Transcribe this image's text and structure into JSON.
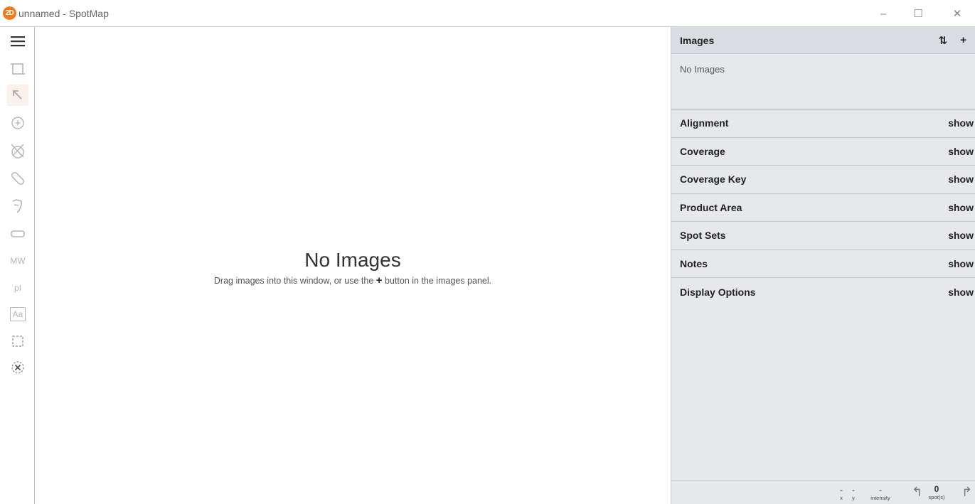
{
  "window": {
    "logo_text": "2D",
    "title": "unnamed - SpotMap",
    "minimize_glyph": "–",
    "maximize_glyph": "☐",
    "close_glyph": "✕"
  },
  "toolbar": {
    "tools": [
      {
        "name": "menu-icon"
      },
      {
        "name": "crop-icon"
      },
      {
        "name": "select-arrow-icon",
        "active": true
      },
      {
        "name": "add-spot-icon"
      },
      {
        "name": "remove-spot-icon"
      },
      {
        "name": "link-icon"
      },
      {
        "name": "undo-spot-icon"
      },
      {
        "name": "shape-rect-icon"
      },
      {
        "name": "mw-tool",
        "label": "MW"
      },
      {
        "name": "pi-tool",
        "label": "pI"
      },
      {
        "name": "text-tool",
        "label": "Aa"
      },
      {
        "name": "marquee-icon"
      },
      {
        "name": "clear-selection-icon"
      }
    ]
  },
  "canvas": {
    "empty_title": "No Images",
    "empty_sub_before": "Drag images into this window, or use the ",
    "empty_sub_plus": "+",
    "empty_sub_after": " button in the images panel."
  },
  "panel": {
    "images_title": "Images",
    "sort_glyph": "⇅",
    "add_glyph": "+",
    "images_empty": "No Images",
    "sections": [
      {
        "title": "Alignment",
        "action": "show"
      },
      {
        "title": "Coverage",
        "action": "show"
      },
      {
        "title": "Coverage Key",
        "action": "show"
      },
      {
        "title": "Product Area",
        "action": "show"
      },
      {
        "title": "Spot Sets",
        "action": "show"
      },
      {
        "title": "Notes",
        "action": "show"
      },
      {
        "title": "Display Options",
        "action": "show"
      }
    ]
  },
  "status": {
    "x_value": "-",
    "x_label": "x",
    "y_value": "-",
    "y_label": "y",
    "intensity_value": "-",
    "intensity_label": "intensity",
    "spots_value": "0",
    "spots_label": "spot(s)",
    "prev_glyph": "↰",
    "next_glyph": "↱"
  }
}
